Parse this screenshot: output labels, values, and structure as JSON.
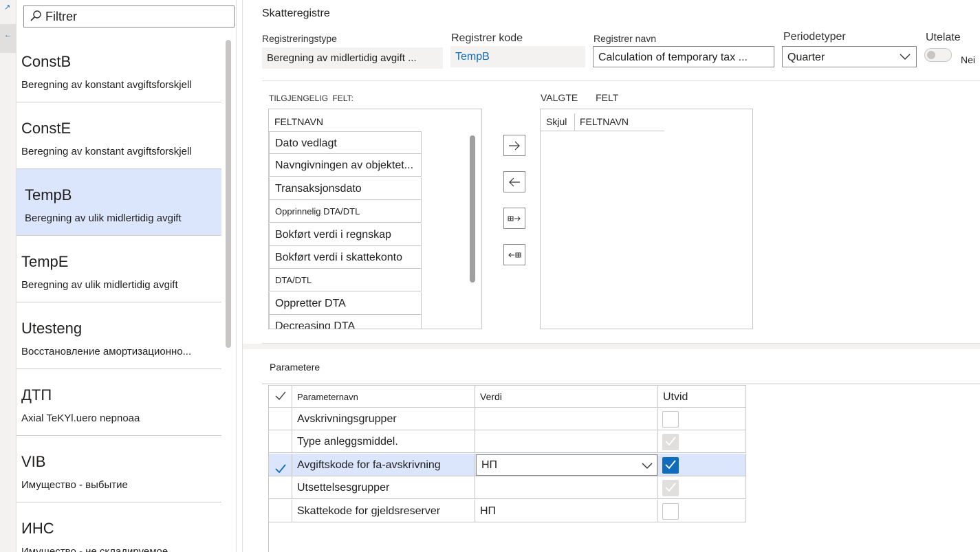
{
  "filter": {
    "placeholder": "Filtrer"
  },
  "list": [
    {
      "code": "ConstB",
      "description": "Beregning av konstant avgiftsforskjell"
    },
    {
      "code": "ConstE",
      "description": "Beregning av konstant avgiftsforskjell"
    },
    {
      "code": "TempB",
      "description": "Beregning av ulik midlertidig avgift",
      "selected": true
    },
    {
      "code": "TempE",
      "description": "Beregning av ulik midlertidig avgift"
    },
    {
      "code": "Utesteng",
      "description": "Восстановление амортизационно..."
    },
    {
      "code": "ДТП",
      "description": "Axial TeKYl.uero nepnoaa"
    },
    {
      "code": "VIB",
      "description": "Имущество - выбытие"
    },
    {
      "code": "ИНС",
      "description": "Имущество - не складируемое"
    }
  ],
  "header": {
    "title": "Skatteregistre",
    "type_label": "Registreringstype",
    "type_value": "Beregning av midlertidig avgift ...",
    "code_label": "Registrer kode",
    "code_value": "TempB",
    "name_label": "Registrer navn",
    "name_value": "Calculation of temporary tax ...",
    "period_label": "Periodetyper",
    "period_value": "Quarter",
    "exclude_label": "Utelate",
    "exclude_value": "Nei"
  },
  "fields": {
    "available_caption_1": "TILGJENGELIG",
    "available_caption_2": "FELT:",
    "available_header": "FELTNAVN",
    "available": [
      {
        "label": "Dato vedlagt"
      },
      {
        "label": "Navngivningen av objektet..."
      },
      {
        "label": "Transaksjonsdato"
      },
      {
        "label": "Opprinnelig DTA/DTL",
        "small": true
      },
      {
        "label": "Bokført verdi i regnskap"
      },
      {
        "label": "Bokført verdi i skattekonto"
      },
      {
        "label": "DTA/DTL",
        "small": true
      },
      {
        "label": "Oppretter DTA"
      },
      {
        "label": "Decreasing DTA"
      }
    ],
    "selected_caption_1": "VALGTE",
    "selected_caption_2": "FELT",
    "selected_col_hide": "Skjul",
    "selected_col_name": "FELTNAVN"
  },
  "parameters": {
    "title": "Parametere",
    "columns": {
      "name": "Parameternavn",
      "value": "Verdi",
      "expand": "Utvid"
    },
    "rows": [
      {
        "name": "Avskrivningsgrupper",
        "value": "",
        "expand": "unchecked"
      },
      {
        "name": "Type anleggsmiddel.",
        "value": "",
        "expand": "disabled-checked"
      },
      {
        "name": "Avgiftskode for fa-avskrivning",
        "value": "НП",
        "expand": "checked",
        "selected": true
      },
      {
        "name": "Utsettelsesgrupper",
        "value": "",
        "expand": "disabled-checked"
      },
      {
        "name": "Skattekode for gjeldsreserver",
        "value": "НП",
        "expand": "unchecked"
      }
    ]
  },
  "colors": {
    "accent": "#0f6cbd",
    "selection": "#dbe5fb",
    "code_link": "#0f6cbd"
  }
}
